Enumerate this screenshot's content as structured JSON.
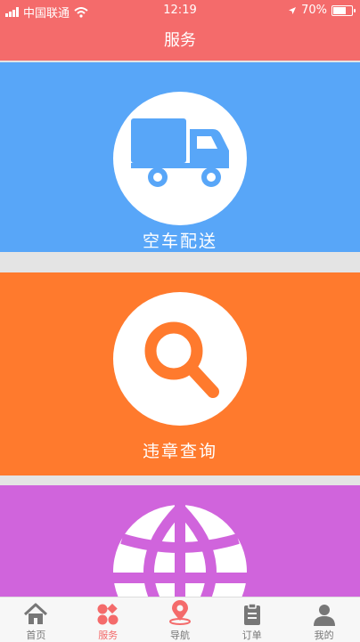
{
  "status": {
    "carrier": "中国联通",
    "time": "12:19",
    "battery": "70%",
    "battery_level": 0.7
  },
  "header": {
    "title": "服务"
  },
  "services": [
    {
      "label": "空车配送",
      "icon": "truck-icon",
      "color": "#58a6f8"
    },
    {
      "label": "违章查询",
      "icon": "search-icon",
      "color": "#ff7a2d"
    },
    {
      "label": "",
      "icon": "globe-icon",
      "color": "#d064dc"
    }
  ],
  "tabbar": {
    "items": [
      {
        "label": "首页",
        "icon": "home-icon"
      },
      {
        "label": "服务",
        "icon": "services-icon",
        "active": true
      },
      {
        "label": "导航",
        "icon": "location-pin-icon"
      },
      {
        "label": "订单",
        "icon": "clipboard-icon"
      },
      {
        "label": "我的",
        "icon": "user-icon"
      }
    ],
    "active_color": "#f46b6b"
  }
}
